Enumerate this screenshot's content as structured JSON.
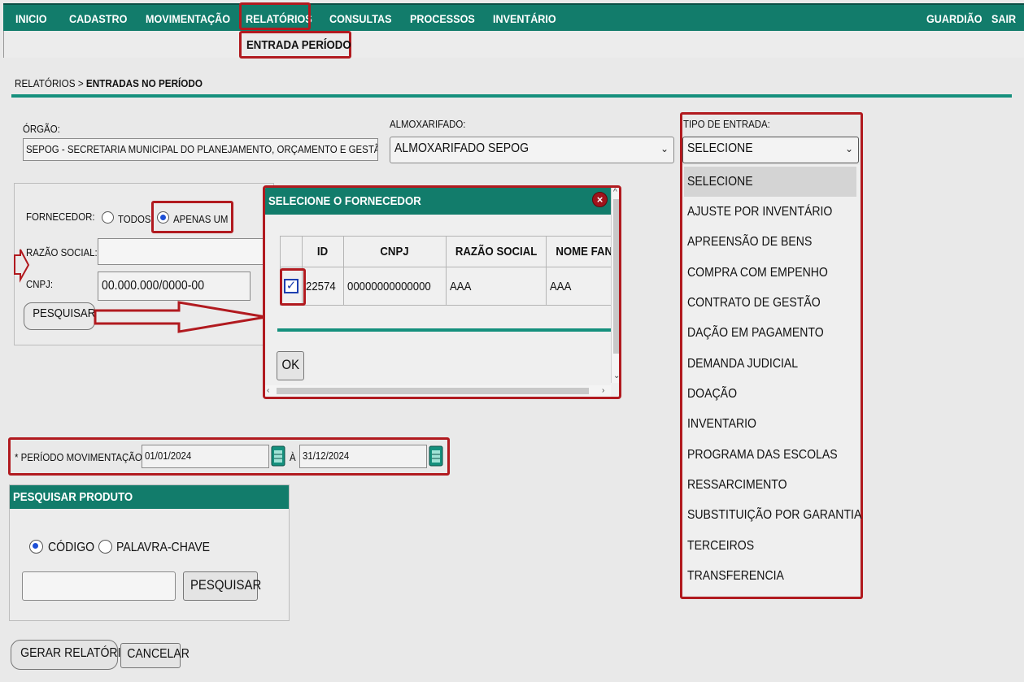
{
  "nav": {
    "items": [
      "INICIO",
      "CADASTRO",
      "MOVIMENTAÇÃO",
      "RELATÓRIOS",
      "CONSULTAS",
      "PROCESSOS",
      "INVENTÁRIO"
    ],
    "right": [
      "GUARDIÃO",
      "SAIR"
    ],
    "submenu": "ENTRADA PERÍODO"
  },
  "breadcrumb": {
    "root": "RELATÓRIOS",
    "sep": ">",
    "current": "ENTRADAS NO PERÍODO"
  },
  "orgao": {
    "label": "ÓRGÃO:",
    "value": "SEPOG - SECRETARIA MUNICIPAL DO PLANEJAMENTO, ORÇAMENTO E GESTÃO"
  },
  "almoxarifado": {
    "label": "ALMOXARIFADO:",
    "value": "ALMOXARIFADO SEPOG"
  },
  "tipo_entrada": {
    "label": "TIPO DE ENTRADA:",
    "value": "SELECIONE",
    "options": [
      "SELECIONE",
      "AJUSTE POR INVENTÁRIO",
      "APREENSÃO DE BENS",
      "COMPRA COM EMPENHO",
      "CONTRATO DE GESTÃO",
      "DAÇÃO EM PAGAMENTO",
      "DEMANDA JUDICIAL",
      "DOAÇÃO",
      "INVENTARIO",
      "PROGRAMA DAS ESCOLAS",
      "RESSARCIMENTO",
      "SUBSTITUIÇÃO POR GARANTIA",
      "TERCEIROS",
      "TRANSFERENCIA"
    ]
  },
  "fornecedor": {
    "label": "FORNECEDOR:",
    "opt_todos": "TODOS",
    "opt_apenas": "APENAS UM",
    "razao_label": "RAZÃO SOCIAL:",
    "cnpj_label": "CNPJ:",
    "cnpj_value": "00.000.000/0000-00",
    "search_button": "PESQUISAR"
  },
  "modal": {
    "title": "SELECIONE O FORNECEDOR",
    "close": "×",
    "columns": [
      "ID",
      "CNPJ",
      "RAZÃO SOCIAL",
      "NOME FANTASIA"
    ],
    "rows": [
      {
        "checked": "✓",
        "id": "22574",
        "cnpj": "00000000000000",
        "razao": "AAA",
        "fantasia": "AAA"
      }
    ],
    "ok": "OK"
  },
  "periodo": {
    "label": "* PERÍODO MOVIMENTAÇÃO:",
    "start": "01/01/2024",
    "sep": "À",
    "end": "31/12/2024"
  },
  "produto": {
    "title": "PESQUISAR PRODUTO",
    "opt_codigo": "CÓDIGO",
    "opt_palavra": "PALAVRA-CHAVE",
    "search_button": "PESQUISAR"
  },
  "actions": {
    "generate": "GERAR RELATÓRIO",
    "cancel": "CANCELAR"
  },
  "colors": {
    "teal": "#127c6b",
    "highlight": "#b11a1f"
  }
}
